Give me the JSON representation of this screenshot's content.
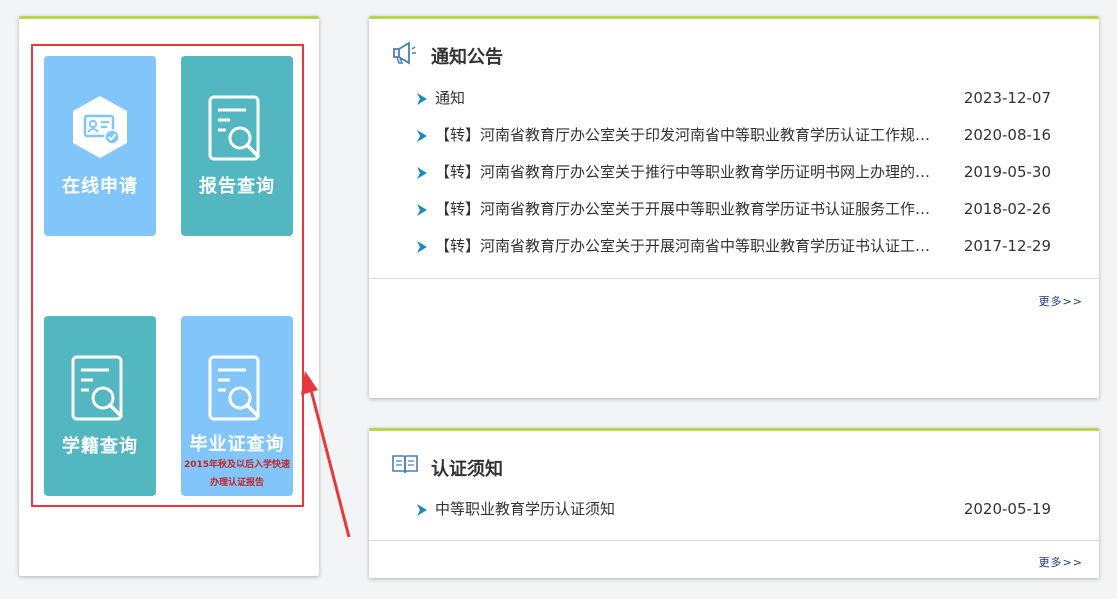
{
  "tiles": {
    "apply": {
      "label": "在线申请",
      "color": "#82c6f9"
    },
    "report": {
      "label": "报告查询",
      "color": "#52b7c1"
    },
    "status": {
      "label": "学籍查询",
      "color": "#52b7c1"
    },
    "diploma": {
      "label": "毕业证查询",
      "note_line1": "2015年秋及以后入学快速",
      "note_line2": "办理认证报告",
      "color": "#82c6f9"
    }
  },
  "notice": {
    "title": "通知公告",
    "items": [
      {
        "title": "通知",
        "date": "2023-12-07"
      },
      {
        "title": "【转】河南省教育厅办公室关于印发河南省中等职业教育学历认证工作规程的通知",
        "date": "2020-08-16"
      },
      {
        "title": "【转】河南省教育厅办公室关于推行中等职业教育学历证明书网上办理的通知",
        "date": "2019-05-30"
      },
      {
        "title": "【转】河南省教育厅办公室关于开展中等职业教育学历证书认证服务工作的通知",
        "date": "2018-02-26"
      },
      {
        "title": "【转】河南省教育厅办公室关于开展河南省中等职业教育学历证书认证工作的通知",
        "date": "2017-12-29"
      }
    ],
    "more": "更多>>"
  },
  "cert": {
    "title": "认证须知",
    "items": [
      {
        "title": "中等职业教育学历认证须知",
        "date": "2020-05-19"
      }
    ],
    "more": "更多>>"
  },
  "colors": {
    "accent_border": "#b7d64b",
    "highlight": "#e8383d",
    "bullet": "#1e88c8"
  }
}
